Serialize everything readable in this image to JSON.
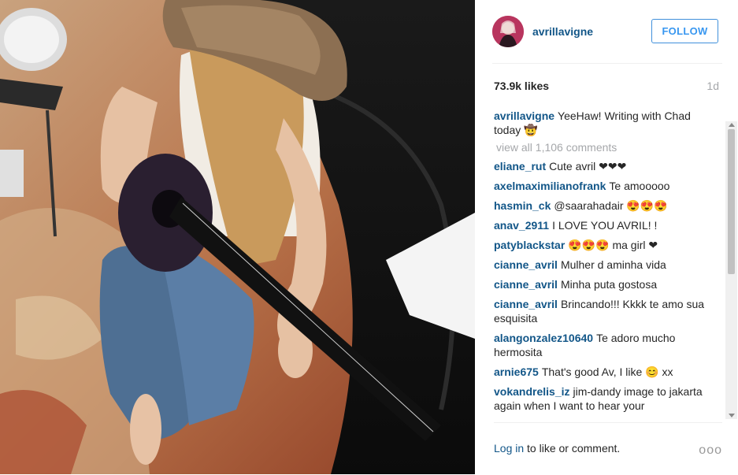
{
  "post": {
    "username": "avrillavigne",
    "follow_label": "FOLLOW",
    "likes": "73.9k likes",
    "age": "1d",
    "caption": {
      "user": "avrillavigne",
      "text": "YeeHaw! Writing with Chad today 🤠"
    },
    "view_all": "view all 1,106 comments",
    "comments": [
      {
        "user": "eliane_rut",
        "text": "Cute avril ❤❤❤"
      },
      {
        "user": "axelmaximilianofrank",
        "text": "Te amooooo"
      },
      {
        "user": "hasmin_ck",
        "text": "@saarahadair 😍😍😍"
      },
      {
        "user": "anav_2911",
        "text": "I LOVE YOU AVRIL! !"
      },
      {
        "user": "patyblackstar",
        "text": "😍😍😍 ma girl ❤"
      },
      {
        "user": "cianne_avril",
        "text": "Mulher d aminha vida"
      },
      {
        "user": "cianne_avril",
        "text": "Minha puta gostosa"
      },
      {
        "user": "cianne_avril",
        "text": "Brincando!!! Kkkk te amo sua esquisita"
      },
      {
        "user": "alangonzalez10640",
        "text": "Te adoro mucho hermosita"
      },
      {
        "user": "arnie675",
        "text": "That's good Av, I like 😊 xx"
      },
      {
        "user": "vokandrelis_iz",
        "text": "jim-dandy image to jakarta again when I want to hear your"
      }
    ],
    "footer": {
      "login_link": "Log in",
      "login_rest": " to like or comment.",
      "more": "ooo"
    }
  },
  "colors": {
    "link": "#125688",
    "follow": "#3897f0",
    "muted": "#a5a7aa"
  },
  "icons": {
    "more": "more-options-icon"
  }
}
